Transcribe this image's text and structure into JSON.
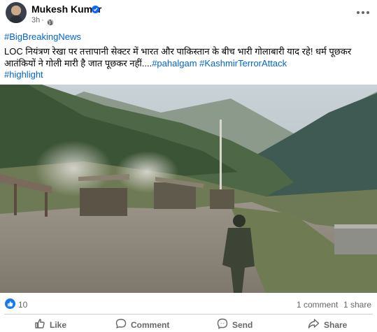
{
  "post": {
    "author": "Mukesh Kumar",
    "verified_icon": "verified-badge-icon",
    "time": "3h",
    "separator": "·",
    "privacy_icon": "globe-icon",
    "menu_icon": "more-options-icon",
    "hashtag_line": "#BigBreakingNews",
    "body_text": "LOC नियंत्रण रेखा पर तत्तापानी सेक्टर में भारत और पाकिस्तान के बीच भारी गोलाबारी याद रहे! धर्म पूछकर आतंकियों ने गोली मारी है जात पूछकर नहीं....",
    "inline_tags": [
      "#pahalgam",
      "#KashmirTerrorAttack"
    ],
    "last_tag": "#highlight"
  },
  "reactions": {
    "icon": "like-reaction-icon",
    "count": "10",
    "comments": "1 comment",
    "shares": "1 share"
  },
  "actions": {
    "like": "Like",
    "comment": "Comment",
    "send": "Send",
    "share": "Share"
  },
  "colors": {
    "link": "#0064d1",
    "brand": "#1877f2",
    "muted": "#65676b"
  }
}
